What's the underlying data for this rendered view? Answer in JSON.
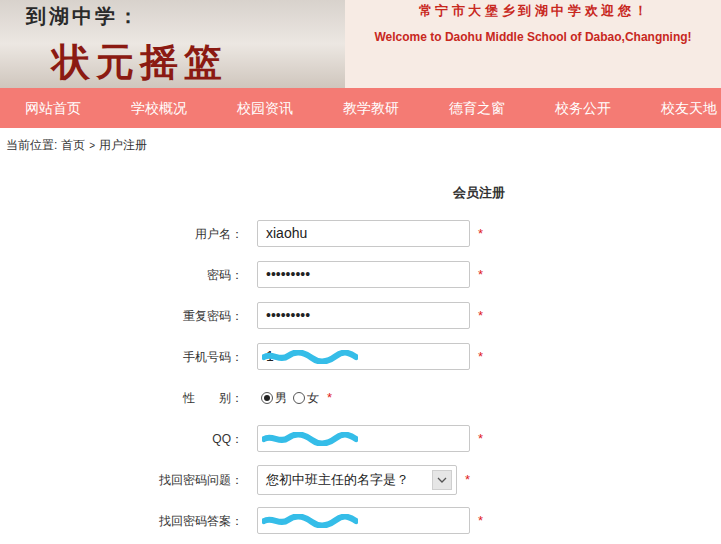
{
  "header": {
    "banner_school": "到湖中学：",
    "banner_motto": "状元摇篮",
    "welcome_cn": "常 宁 市 大 堡 乡 到 湖 中 学 欢 迎 您 ！",
    "welcome_en": "Welcome to Daohu Middle School of Dabao,Changning!"
  },
  "nav": [
    {
      "label": "网站首页",
      "selected": false
    },
    {
      "label": "学校概况",
      "selected": false
    },
    {
      "label": "校园资讯",
      "selected": false
    },
    {
      "label": "教学教研",
      "selected": false
    },
    {
      "label": "德育之窗",
      "selected": false
    },
    {
      "label": "校务公开",
      "selected": false
    },
    {
      "label": "校友天地",
      "selected": false
    }
  ],
  "breadcrumb": {
    "prefix": "当前位置:",
    "items": [
      "首页",
      "用户注册"
    ],
    "separator": ">"
  },
  "form": {
    "title": "会员注册",
    "required_mark": "*",
    "fields": [
      {
        "kind": "text",
        "label": "用户名：",
        "value": "xiaohu",
        "redacted": false
      },
      {
        "kind": "text",
        "label": "密码：",
        "value": "•••••••••",
        "redacted": false
      },
      {
        "kind": "text",
        "label": "重复密码：",
        "value": "•••••••••",
        "redacted": false
      },
      {
        "kind": "text",
        "label": "手机号码：",
        "value": "1",
        "redacted": true
      },
      {
        "kind": "radio",
        "label": "性　　别：",
        "options": [
          {
            "label": "男",
            "selected": true
          },
          {
            "label": "女",
            "selected": false
          }
        ]
      },
      {
        "kind": "text",
        "label": "QQ：",
        "value": "",
        "redacted": true
      },
      {
        "kind": "select",
        "label": "找回密码问题：",
        "value": "您初中班主任的名字是？"
      },
      {
        "kind": "text",
        "label": "找回密码答案：",
        "value": "",
        "redacted": true
      }
    ]
  }
}
